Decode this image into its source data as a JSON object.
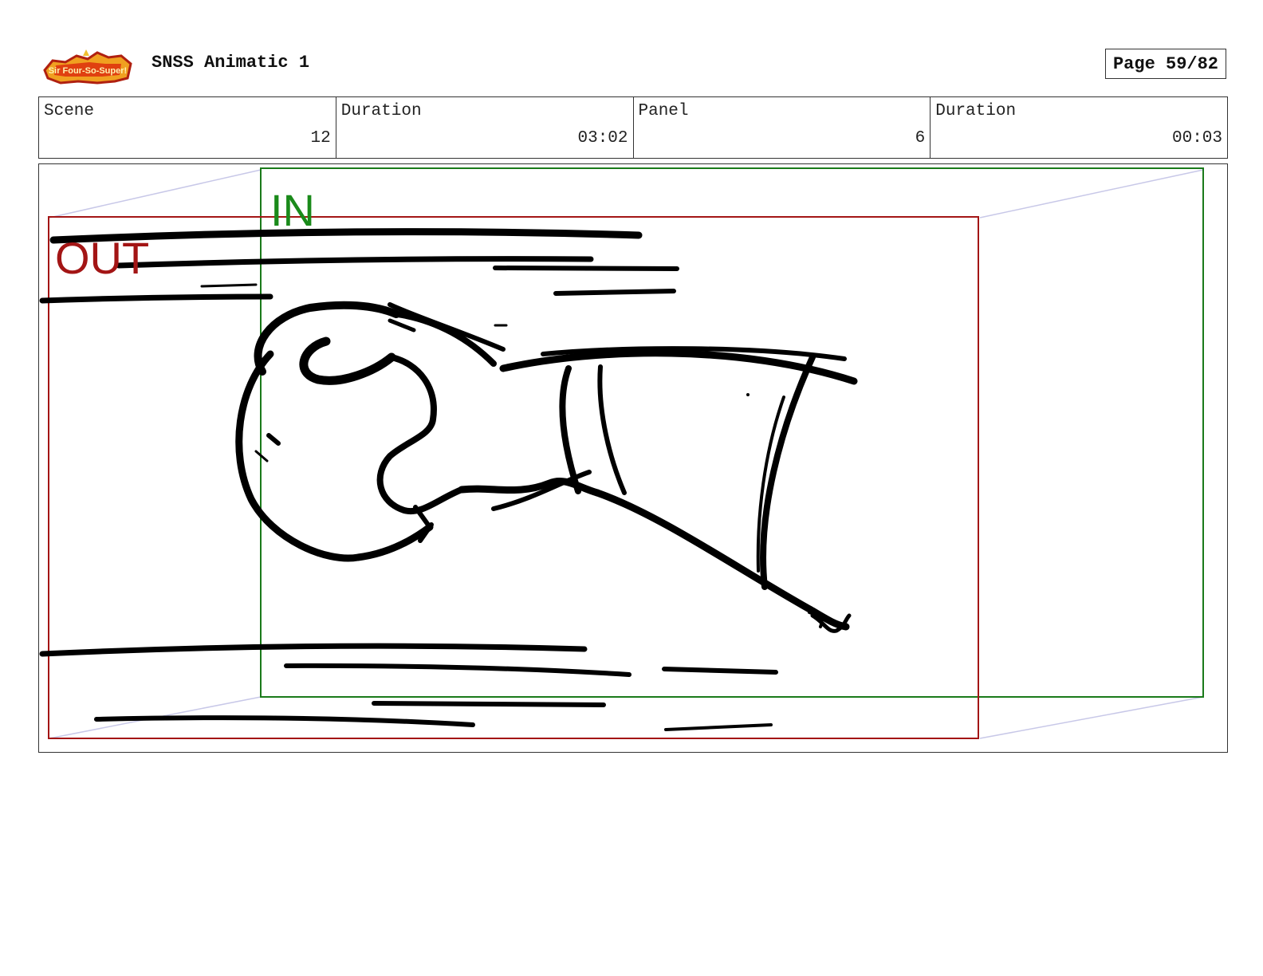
{
  "header": {
    "logo_text": "Sir Four-So-Super!",
    "title": "SNSS Animatic 1",
    "page": "Page 59/82"
  },
  "info": {
    "scene_label": "Scene",
    "scene_value": "12",
    "scene_duration_label": "Duration",
    "scene_duration_value": "03:02",
    "panel_label": "Panel",
    "panel_value": "6",
    "panel_duration_label": "Duration",
    "panel_duration_value": "00:03"
  },
  "frame": {
    "in_label": "IN",
    "out_label": "OUT",
    "in_color": "#1a8a1a",
    "out_color": "#a31515",
    "camera_arrow_color": "#c8c8e8"
  }
}
